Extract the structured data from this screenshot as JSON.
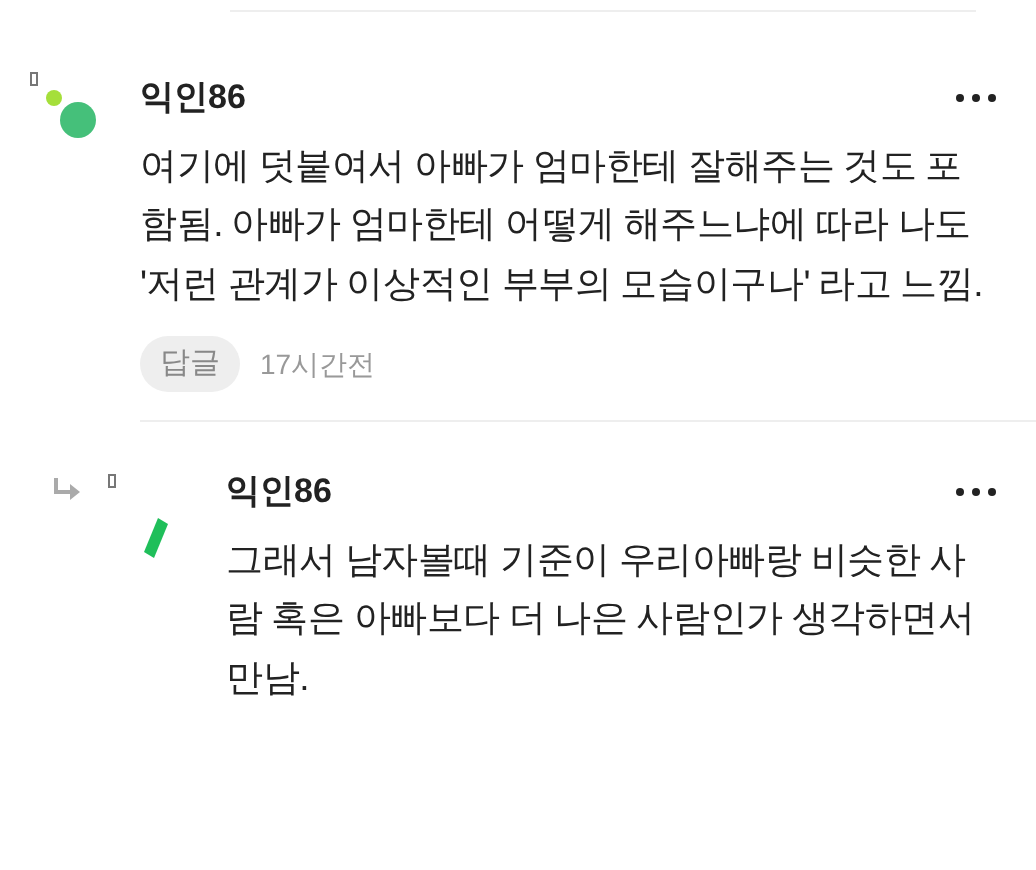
{
  "comments": [
    {
      "author": "익인86",
      "text": "여기에 덧붙여서 아빠가 엄마한테 잘해주는 것도 포함됨. 아빠가 엄마한테 어떻게 해주느냐에 따라 나도 '저런 관계가 이상적인 부부의 모습이구나' 라고 느낌.",
      "reply_label": "답글",
      "time": "17시간전",
      "is_reply": false
    },
    {
      "author": "익인86",
      "text": "그래서 남자볼때 기준이 우리아빠랑 비슷한 사람 혹은 아빠보다 더 나은 사람인가 생각하면서 만남.",
      "is_reply": true
    }
  ]
}
